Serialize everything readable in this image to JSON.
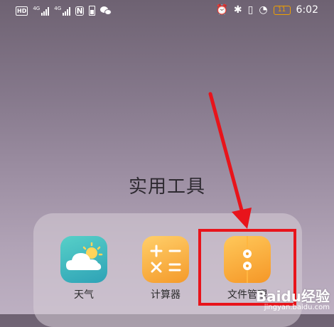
{
  "status_bar": {
    "left": {
      "hd_badge": "HD",
      "network_1": "4G",
      "network_2": "4G",
      "nfc": "N"
    },
    "right": {
      "battery_level": "11",
      "time": "6:02"
    },
    "icons": [
      "hd-icon",
      "signal-icon",
      "nfc-icon",
      "battery-saver-icon",
      "wechat-icon",
      "alarm-icon",
      "bluetooth-icon",
      "vibrate-icon",
      "speedometer-icon",
      "battery-icon"
    ],
    "battery_color": "#f0a000"
  },
  "folder": {
    "title": "实用工具",
    "apps": [
      {
        "name": "weather",
        "label": "天气",
        "icon": "weather-cloud-sun-icon",
        "color": "#3fb8c0"
      },
      {
        "name": "calculator",
        "label": "计算器",
        "icon": "calculator-icon",
        "color": "#f6a934"
      },
      {
        "name": "file-manager",
        "label": "文件管理",
        "icon": "file-folder-icon",
        "color": "#f6a030"
      }
    ]
  },
  "annotation": {
    "highlight_color": "#e8141b"
  },
  "watermark": {
    "main": "Baidu经验",
    "sub": "jingyan.baidu.com"
  }
}
